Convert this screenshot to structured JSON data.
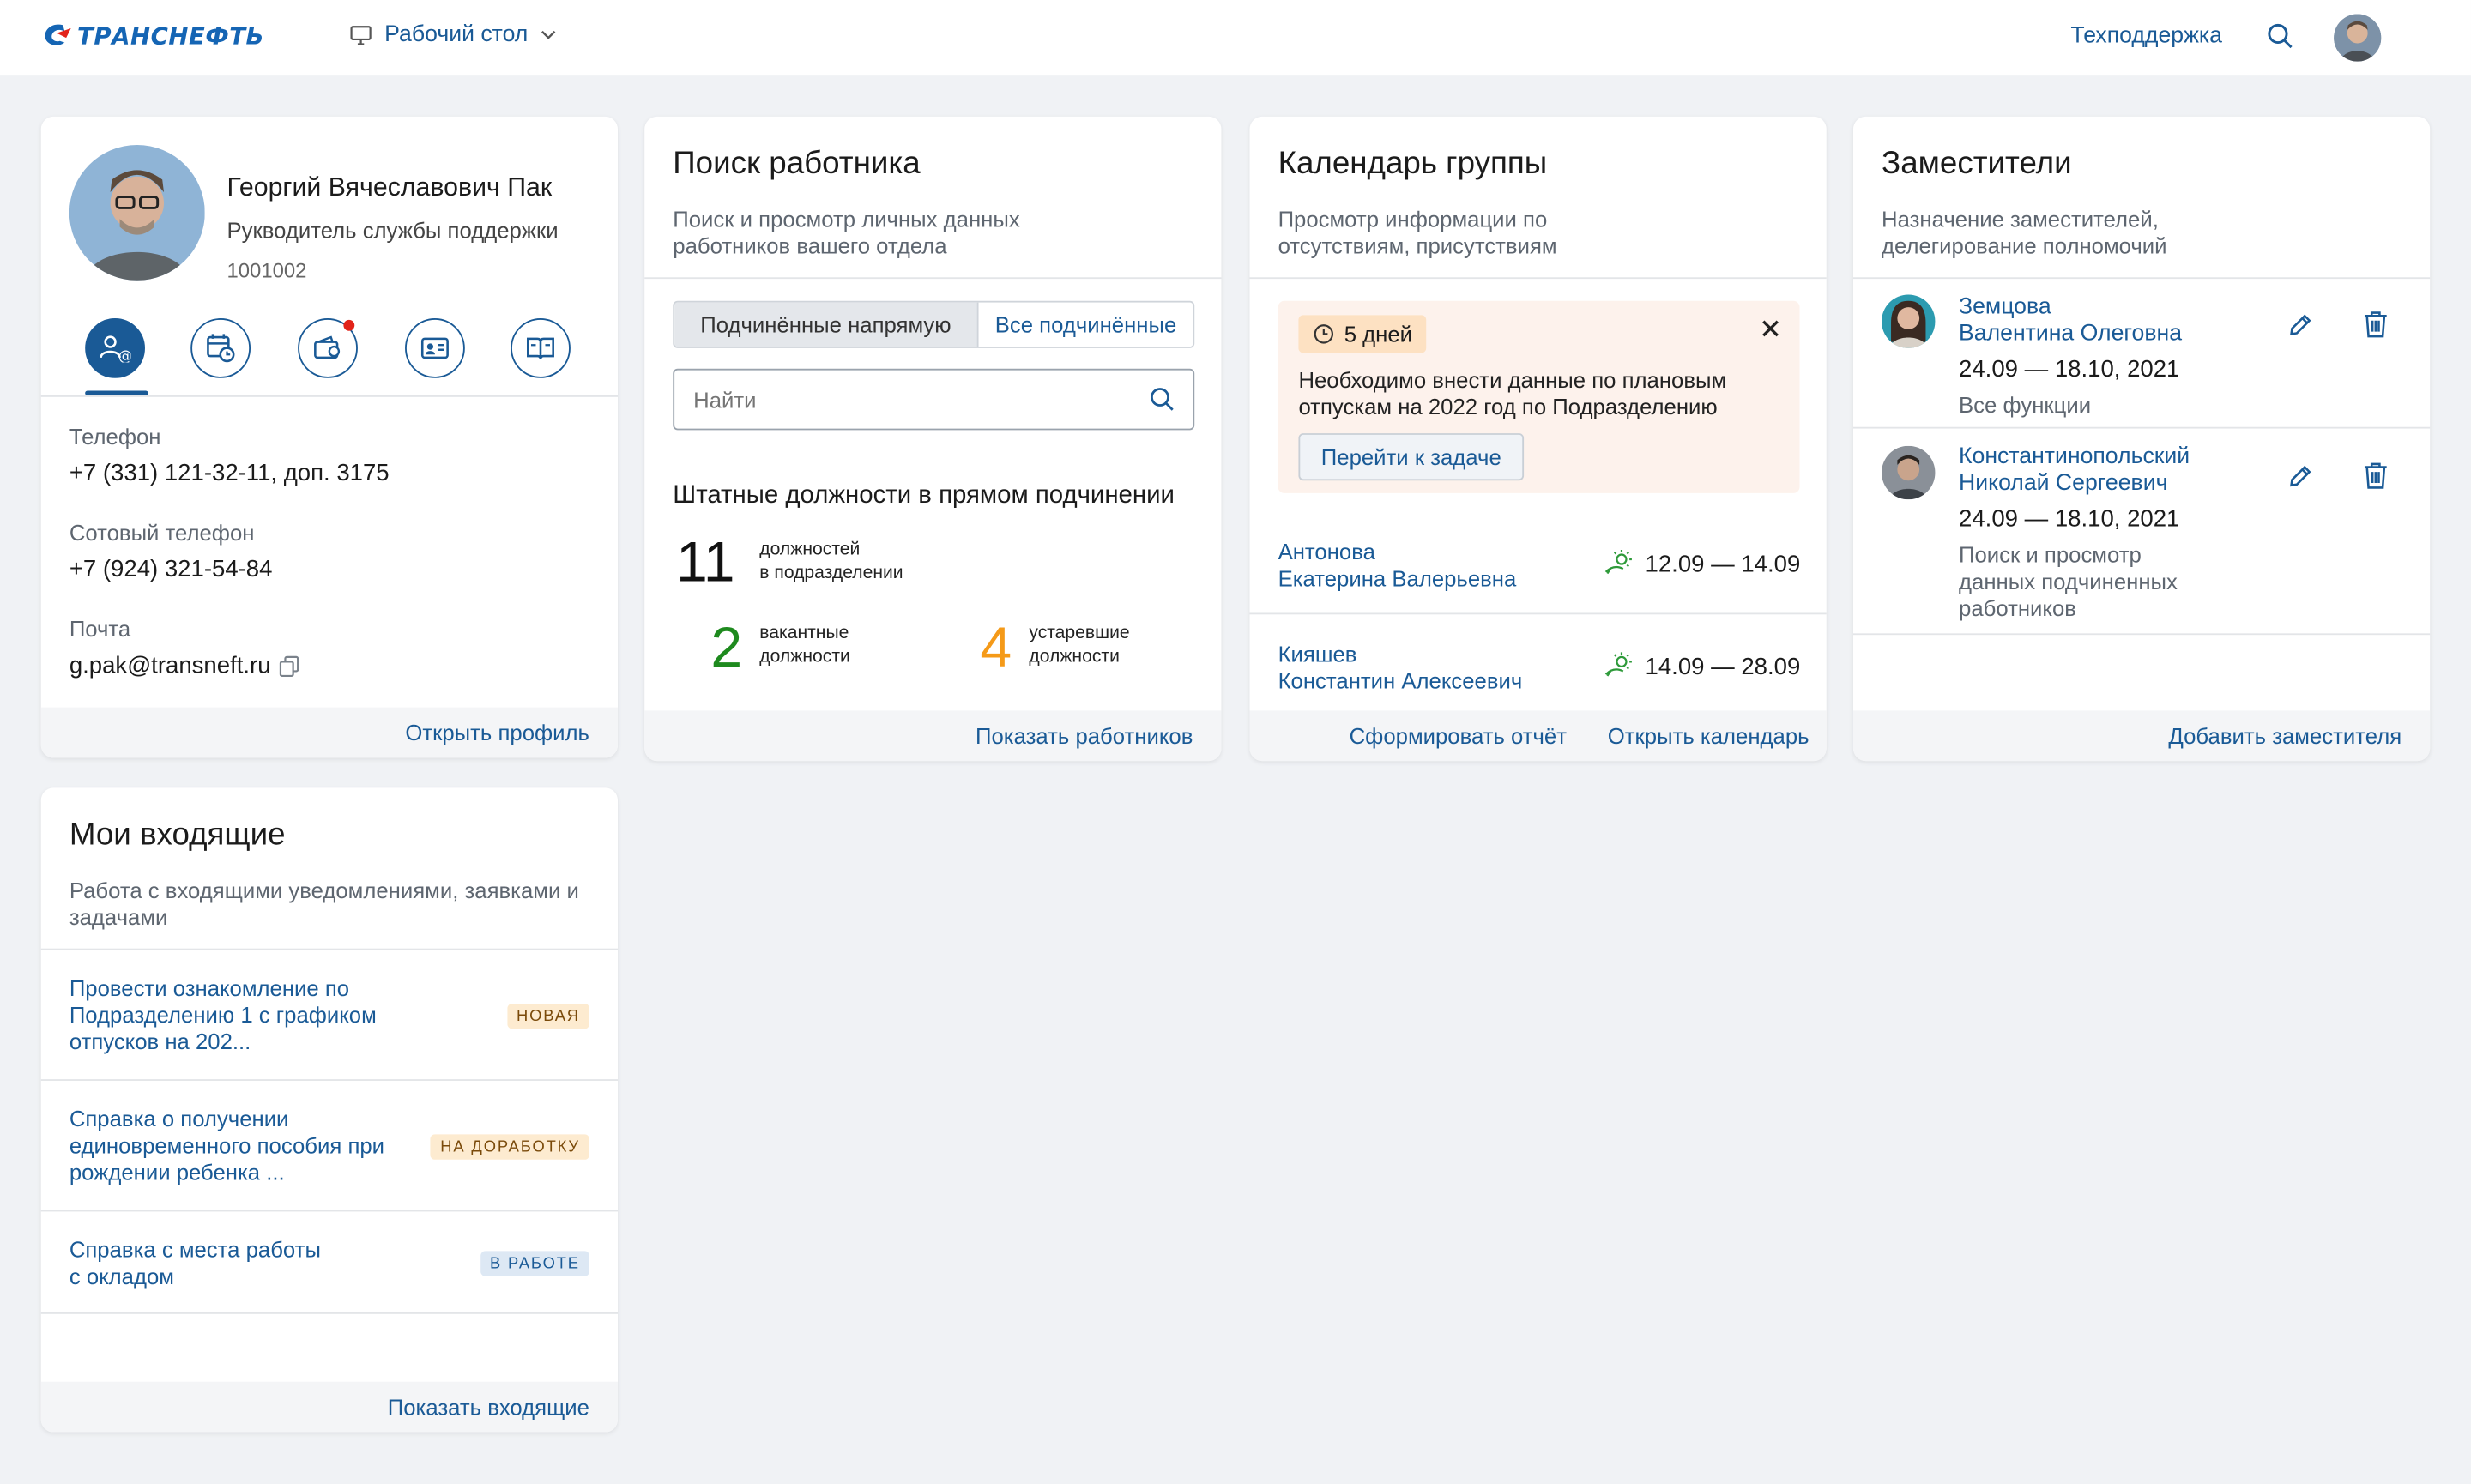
{
  "header": {
    "logo_text": "ТРАНСНЕФТЬ",
    "desktop_label": "Рабочий стол",
    "support_label": "Техподдержка"
  },
  "profile": {
    "name": "Георгий Вячеславович Пак",
    "role": "Рукводитель службы поддержки",
    "tab_number": "1001002",
    "phone_label": "Телефон",
    "phone_value": "+7 (331) 121-32-11, доп. 3175",
    "mobile_label": "Сотовый телефон",
    "mobile_value": "+7 (924) 321-54-84",
    "email_label": "Почта",
    "email_value": "g.pak@transneft.ru",
    "footer_link": "Открыть профиль"
  },
  "search_card": {
    "title": "Поиск работника",
    "subtitle": "Поиск и просмотр личных данных работников вашего отдела",
    "seg_direct": "Подчинённые напрямую",
    "seg_all": "Все подчинённые",
    "search_placeholder": "Найти",
    "positions_heading": "Штатные должности в прямом подчинении",
    "total_num": "11",
    "total_label_1": "должностей",
    "total_label_2": "в подразделении",
    "vacant_num": "2",
    "vacant_label_1": "вакантные",
    "vacant_label_2": "должности",
    "obsolete_num": "4",
    "obsolete_label_1": "устаревшие",
    "obsolete_label_2": "должности",
    "footer_link": "Показать работников",
    "colors": {
      "vacant": "#1e8a1e",
      "obsolete": "#f59a18"
    }
  },
  "calendar_card": {
    "title": "Календарь группы",
    "subtitle": "Просмотр информации по отсутствиям, присутствиям",
    "alert_days": "5 дней",
    "alert_text": "Необходимо внести данные по плановым отпускам на 2022 год по Подразделению",
    "alert_button": "Перейти к задаче",
    "rows": [
      {
        "name1": "Антонова",
        "name2": "Екатерина Валерьевна",
        "dates": "12.09 — 14.09"
      },
      {
        "name1": "Кияшев",
        "name2": "Константин Алексеевич",
        "dates": "14.09 — 28.09"
      }
    ],
    "footer_report": "Сформировать отчёт",
    "footer_calendar": "Открыть календарь"
  },
  "deputies_card": {
    "title": "Заместители",
    "subtitle": "Назначение заместителей, делегирование полномочий",
    "rows": [
      {
        "name1": "Земцова",
        "name2": "Валентина Олеговна",
        "dates": "24.09 — 18.10, 2021",
        "scope": "Все функции"
      },
      {
        "name1": "Константинопольский",
        "name2": "Николай Сергеевич",
        "dates": "24.09 — 18.10, 2021",
        "scope": "Поиск и просмотр данных подчиненных работников"
      }
    ],
    "footer_link": "Добавить заместителя"
  },
  "inbox_card": {
    "title": "Мои входящие",
    "subtitle": "Работа с входящими уведомлениями, заявками и задачами",
    "items": [
      {
        "text": "Провести ознакомление по Подразделению 1 с графиком отпусков на 202...",
        "badge": "НОВАЯ"
      },
      {
        "text": "Справка о получении единовременного пособия при рождении ребенка ...",
        "badge": "НА ДОРАБОТКУ"
      },
      {
        "text": "Справка с места работы с окладом",
        "badge": "В РАБОТЕ"
      }
    ],
    "footer_link": "Показать входящие"
  }
}
